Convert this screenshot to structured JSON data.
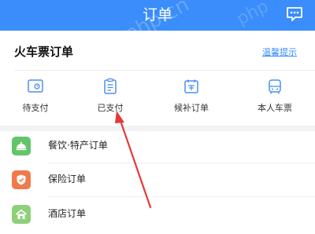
{
  "header": {
    "title": "订单",
    "message_icon": "message-icon",
    "bg_color": "#3a8dfa",
    "watermark": "php.cn",
    "watermark2": "php"
  },
  "train_orders": {
    "title": "火车票订单",
    "tip_link": "温馨提示",
    "order_types": [
      {
        "label": "待支付",
        "icon": "unpaid-icon"
      },
      {
        "label": "已支付",
        "icon": "paid-icon"
      },
      {
        "label": "候补订单",
        "icon": "waitlist-icon"
      },
      {
        "label": "本人车票",
        "icon": "my-ticket-icon"
      }
    ]
  },
  "other_orders": [
    {
      "label": "餐饮·特产订单",
      "icon": "food-icon",
      "color": "#64c46a"
    },
    {
      "label": "保险订单",
      "icon": "insurance-icon",
      "color": "#f07a4a"
    },
    {
      "label": "酒店订单",
      "icon": "hotel-icon",
      "color": "#8dd07a"
    }
  ],
  "annotation": {
    "arrow_color": "#e33a3a"
  }
}
